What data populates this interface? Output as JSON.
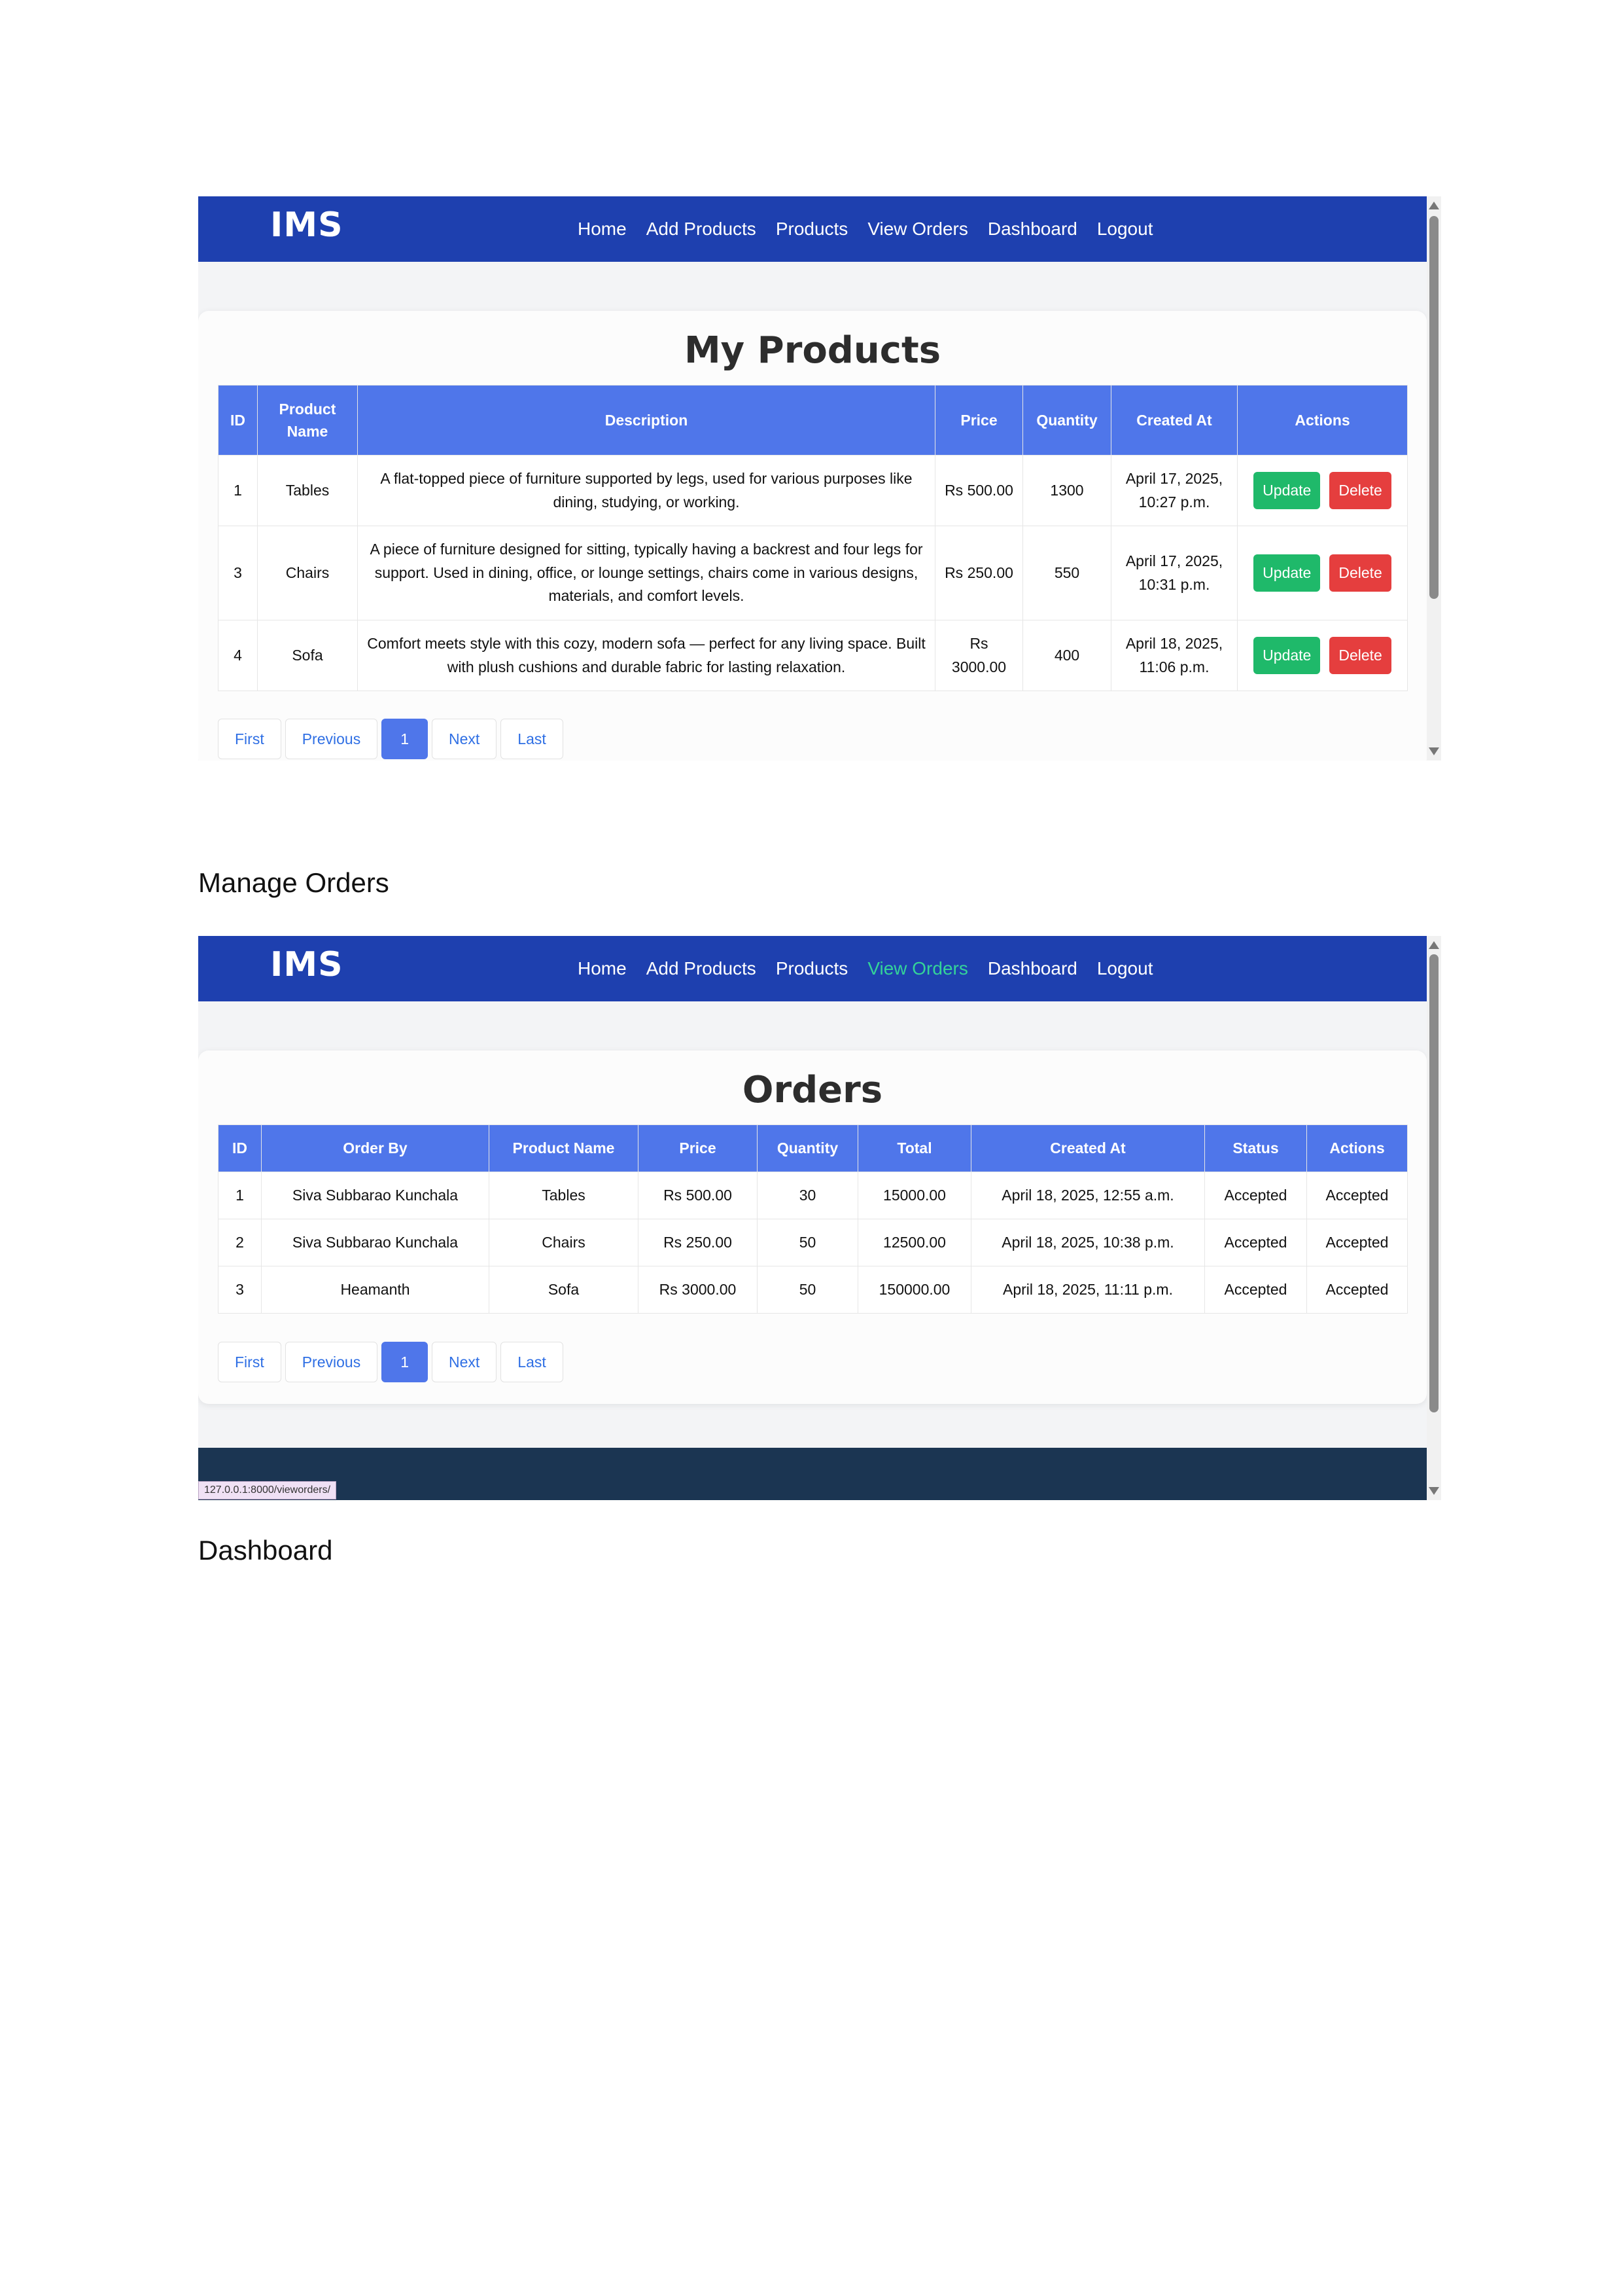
{
  "products_screen": {
    "brand": "IMS",
    "nav": [
      "Home",
      "Add Products",
      "Products",
      "View Orders",
      "Dashboard",
      "Logout"
    ],
    "title": "My Products",
    "columns": [
      "ID",
      "Product Name",
      "Description",
      "Price",
      "Quantity",
      "Created At",
      "Actions"
    ],
    "rows": [
      {
        "id": "1",
        "name": "Tables",
        "description": "A flat-topped piece of furniture supported by legs, used for various purposes like dining, studying, or working.",
        "price": "Rs 500.00",
        "quantity": "1300",
        "created": "April 17, 2025, 10:27 p.m."
      },
      {
        "id": "3",
        "name": "Chairs",
        "description": "A piece of furniture designed for sitting, typically having a backrest and four legs for support. Used in dining, office, or lounge settings, chairs come in various designs, materials, and comfort levels.",
        "price": "Rs 250.00",
        "quantity": "550",
        "created": "April 17, 2025, 10:31 p.m."
      },
      {
        "id": "4",
        "name": "Sofa",
        "description": "Comfort meets style with this cozy, modern sofa — perfect for any living space. Built with plush cushions and durable fabric for lasting relaxation.",
        "price": "Rs 3000.00",
        "quantity": "400",
        "created": "April 18, 2025, 11:06 p.m."
      }
    ],
    "update_label": "Update",
    "delete_label": "Delete",
    "pagination": {
      "first": "First",
      "previous": "Previous",
      "current": "1",
      "next": "Next",
      "last": "Last"
    }
  },
  "orders_heading": "Manage Orders",
  "orders_screen": {
    "brand": "IMS",
    "nav": [
      "Home",
      "Add Products",
      "Products",
      "View Orders",
      "Dashboard",
      "Logout"
    ],
    "active_nav": "View Orders",
    "title": "Orders",
    "columns": [
      "ID",
      "Order By",
      "Product Name",
      "Price",
      "Quantity",
      "Total",
      "Created At",
      "Status",
      "Actions"
    ],
    "rows": [
      {
        "id": "1",
        "order_by": "Siva Subbarao Kunchala",
        "product": "Tables",
        "price": "Rs 500.00",
        "quantity": "30",
        "total": "15000.00",
        "created": "April 18, 2025, 12:55 a.m.",
        "status": "Accepted",
        "action": "Accepted"
      },
      {
        "id": "2",
        "order_by": "Siva Subbarao Kunchala",
        "product": "Chairs",
        "price": "Rs 250.00",
        "quantity": "50",
        "total": "12500.00",
        "created": "April 18, 2025, 10:38 p.m.",
        "status": "Accepted",
        "action": "Accepted"
      },
      {
        "id": "3",
        "order_by": "Heamanth",
        "product": "Sofa",
        "price": "Rs 3000.00",
        "quantity": "50",
        "total": "150000.00",
        "created": "April 18, 2025, 11:11 p.m.",
        "status": "Accepted",
        "action": "Accepted"
      }
    ],
    "pagination": {
      "first": "First",
      "previous": "Previous",
      "current": "1",
      "next": "Next",
      "last": "Last"
    },
    "status_url": "127.0.0.1:8000/vieworders/"
  },
  "dashboard_heading": "Dashboard",
  "colors": {
    "navbar": "#1e40af",
    "table_header": "#4f76ea",
    "update": "#1fb96a",
    "delete": "#e53e3e",
    "active_nav": "#34d399",
    "footer": "#1b3552"
  }
}
